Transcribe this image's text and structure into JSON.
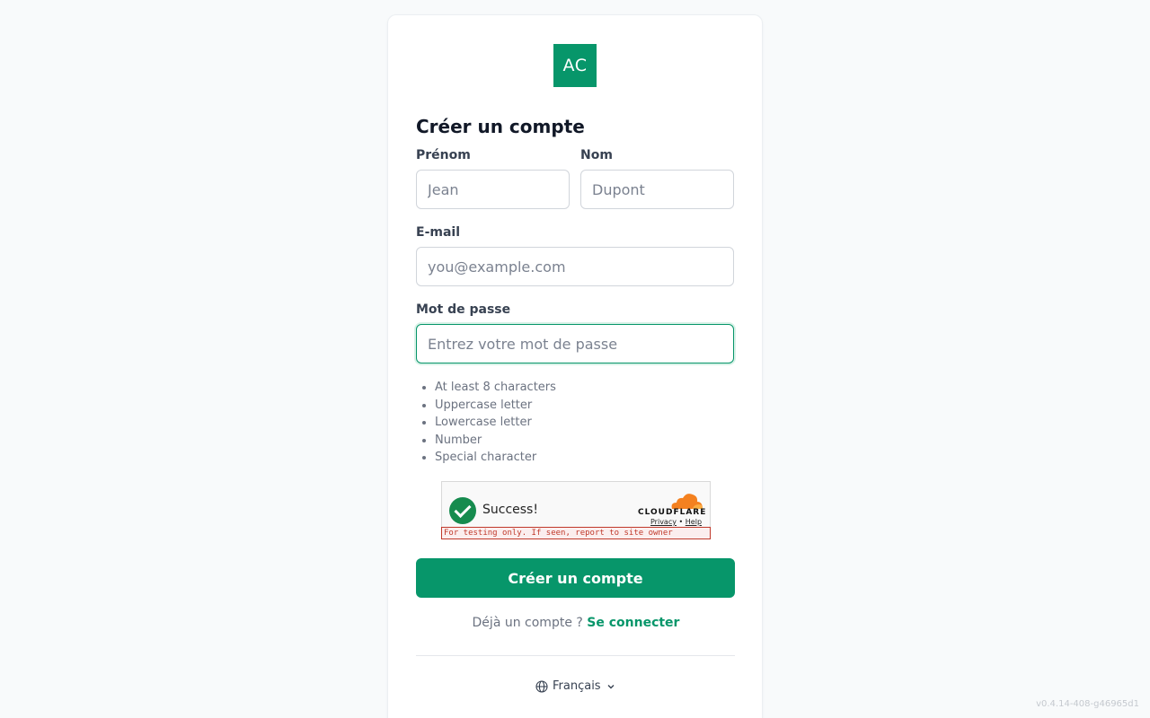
{
  "form": {
    "logo_text": "AC",
    "title": "Créer un compte",
    "first_name": {
      "label": "Prénom",
      "placeholder": "Jean",
      "value": ""
    },
    "last_name": {
      "label": "Nom",
      "placeholder": "Dupont",
      "value": ""
    },
    "email": {
      "label": "E-mail",
      "placeholder": "you@example.com",
      "value": ""
    },
    "password": {
      "label": "Mot de passe",
      "placeholder": "Entrez votre mot de passe",
      "value": ""
    },
    "password_rules": [
      "At least 8 characters",
      "Uppercase letter",
      "Lowercase letter",
      "Number",
      "Special character"
    ],
    "submit_label": "Créer un compte",
    "login_prompt": "Déjà un compte ?",
    "login_link": "Se connecter"
  },
  "captcha": {
    "status": "Success!",
    "brand": "CLOUDFLARE",
    "privacy_link": "Privacy",
    "help_link": "Help",
    "separator": "•",
    "warning": "For testing only. If seen, report to site owner"
  },
  "language": {
    "current": "Français",
    "icon": "globe-icon"
  },
  "version": "v0.4.14-408-g46965d1",
  "colors": {
    "brand": "#07966a",
    "background": "#f8fafb",
    "captcha_check": "#168b4e",
    "cloudflare_orange": "#f48120",
    "warning": "#c0392b"
  }
}
